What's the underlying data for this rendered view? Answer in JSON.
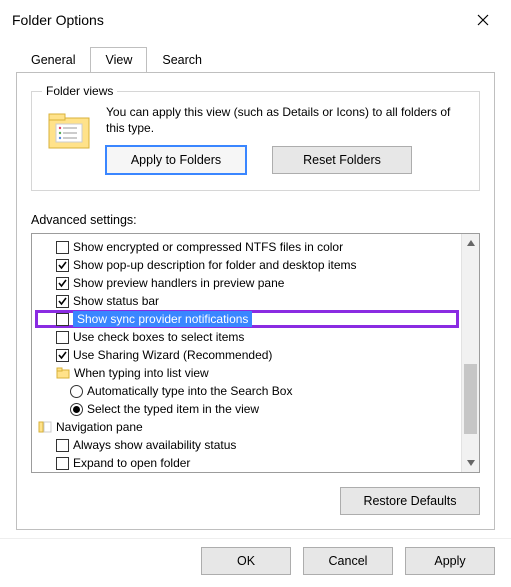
{
  "window": {
    "title": "Folder Options"
  },
  "tabs": {
    "general": "General",
    "view": "View",
    "search": "Search"
  },
  "folder_views": {
    "legend": "Folder views",
    "text": "You can apply this view (such as Details or Icons) to all folders of this type.",
    "apply": "Apply to Folders",
    "reset": "Reset Folders"
  },
  "advanced": {
    "label": "Advanced settings:",
    "items": {
      "ntfs": "Show encrypted or compressed NTFS files in color",
      "popup": "Show pop-up description for folder and desktop items",
      "preview": "Show preview handlers in preview pane",
      "status": "Show status bar",
      "sync": "Show sync provider notifications",
      "checkboxes": "Use check boxes to select items",
      "sharing": "Use Sharing Wizard (Recommended)",
      "typing_header": "When typing into list view",
      "typing_auto": "Automatically type into the Search Box",
      "typing_select": "Select the typed item in the view",
      "nav_header": "Navigation pane",
      "nav_avail": "Always show availability status",
      "nav_expand": "Expand to open folder"
    }
  },
  "buttons": {
    "restore": "Restore Defaults",
    "ok": "OK",
    "cancel": "Cancel",
    "apply": "Apply"
  }
}
